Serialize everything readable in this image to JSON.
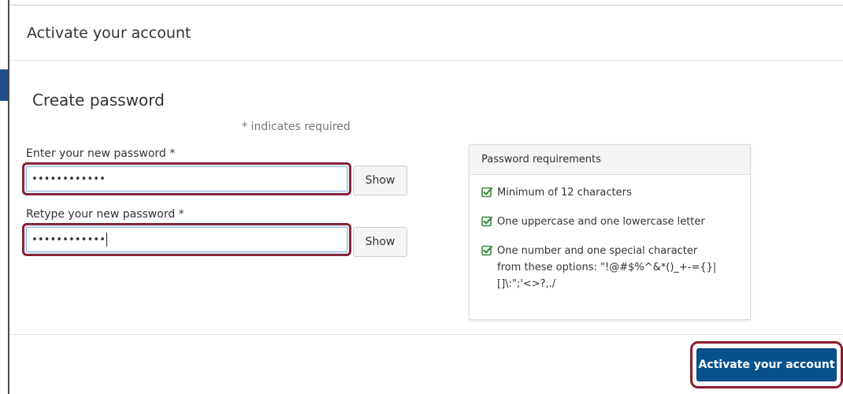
{
  "modal": {
    "title": "Activate your account"
  },
  "form": {
    "heading": "Create password",
    "required_note": "* indicates required",
    "new_password": {
      "label": "Enter your new password *",
      "value": "••••••••••••",
      "show_label": "Show"
    },
    "retype_password": {
      "label": "Retype your new password *",
      "value": "••••••••••••",
      "show_label": "Show"
    }
  },
  "requirements": {
    "title": "Password requirements",
    "items": [
      {
        "text": "Minimum of 12 characters",
        "met": true
      },
      {
        "text": "One uppercase and one lowercase letter",
        "met": true
      },
      {
        "text": "One number and one special character\nfrom these options: \"!@#$%^&*()_+-={}|\n[]\\:\";'<>?,./",
        "met": true
      }
    ],
    "check_color": "#3c8a3c"
  },
  "footer": {
    "activate_label": "Activate your account"
  },
  "colors": {
    "highlight": "#8b1c2c",
    "primary": "#07528e"
  }
}
